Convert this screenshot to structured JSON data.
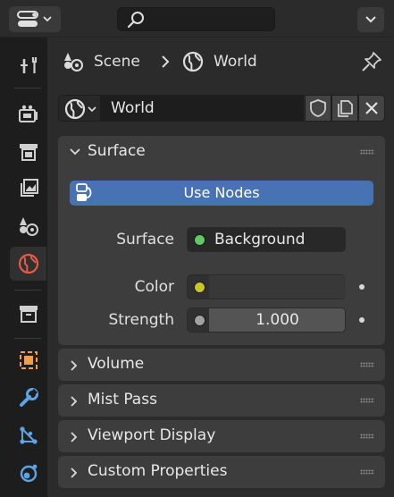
{
  "breadcrumb": {
    "scene": "Scene",
    "world": "World"
  },
  "datablock": {
    "name": "World"
  },
  "panels": {
    "surface": "Surface",
    "volume": "Volume",
    "mist": "Mist Pass",
    "viewport": "Viewport Display",
    "custom": "Custom Properties"
  },
  "surface": {
    "use_nodes": "Use Nodes",
    "surface_label": "Surface",
    "surface_value": "Background",
    "color_label": "Color",
    "strength_label": "Strength",
    "strength_value": "1.000"
  },
  "colors": {
    "accent": "#4772b3",
    "shader_socket": "#63c763",
    "color_socket": "#c7c729",
    "float_socket": "#a1a1a1",
    "world_tab_icon": "#e55a4a"
  },
  "icons": {
    "header": [
      "editor-type-icon",
      "search-icon",
      "chevron-down-icon"
    ],
    "tabs": [
      "tool-icon",
      "render-icon",
      "output-icon",
      "view-layer-icon",
      "scene-icon",
      "world-icon",
      "collection-icon",
      "object-icon",
      "modifier-icon",
      "particles-icon",
      "physics-icon"
    ]
  }
}
